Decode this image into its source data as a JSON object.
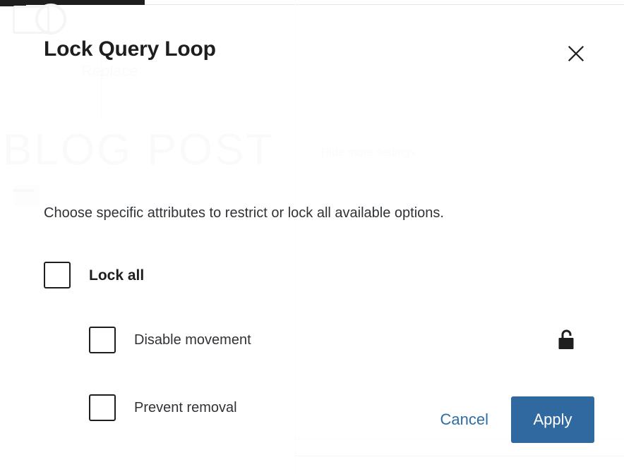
{
  "modal": {
    "title": "Lock Query Loop",
    "description": "Choose specific attributes to restrict or lock all available options.",
    "close_label": "Close",
    "close_icon": "close-icon",
    "options": [
      {
        "label": "Lock all",
        "checked": false,
        "emphasis": "bold",
        "lock_icon": null
      },
      {
        "label": "Disable movement",
        "checked": false,
        "emphasis": "normal",
        "lock_icon": "unlock-icon"
      },
      {
        "label": "Prevent removal",
        "checked": false,
        "emphasis": "normal",
        "lock_icon": "unlock-icon"
      }
    ],
    "footer": {
      "cancel_label": "Cancel",
      "apply_label": "Apply"
    }
  },
  "backdrop": {
    "heading_text": "BLOG POST",
    "settings_text": "Hide more settings",
    "replace_text": "Replace",
    "dots_text": "···"
  },
  "colors": {
    "accent_blue": "#30699f",
    "link_blue": "#2e6da4",
    "text_dark": "#1e1e1e",
    "text_body": "#2f3337",
    "surface": "#ffffff",
    "border": "#1e1e1e"
  }
}
